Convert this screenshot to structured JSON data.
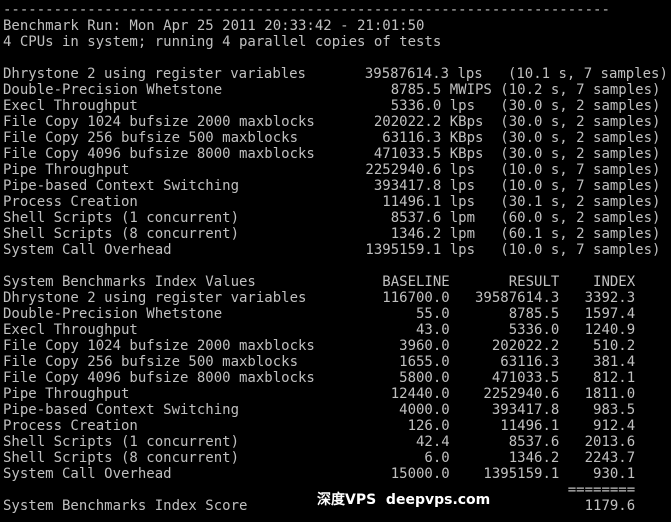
{
  "terminal": {
    "lines": [
      "------------------------------------------------------------------------",
      "Benchmark Run: Mon Apr 25 2011 20:33:42 - 21:01:50",
      "4 CPUs in system; running 4 parallel copies of tests",
      "",
      "Dhrystone 2 using register variables       39587614.3 lps   (10.1 s, 7 samples)",
      "Double-Precision Whetstone                    8785.5 MWIPS (10.2 s, 7 samples)",
      "Execl Throughput                              5336.0 lps   (30.0 s, 2 samples)",
      "File Copy 1024 bufsize 2000 maxblocks       202022.2 KBps  (30.0 s, 2 samples)",
      "File Copy 256 bufsize 500 maxblocks          63116.3 KBps  (30.0 s, 2 samples)",
      "File Copy 4096 bufsize 8000 maxblocks       471033.5 KBps  (30.0 s, 2 samples)",
      "Pipe Throughput                            2252940.6 lps   (10.0 s, 7 samples)",
      "Pipe-based Context Switching                393417.8 lps   (10.0 s, 7 samples)",
      "Process Creation                             11496.1 lps   (30.1 s, 2 samples)",
      "Shell Scripts (1 concurrent)                  8537.6 lpm   (60.0 s, 2 samples)",
      "Shell Scripts (8 concurrent)                  1346.2 lpm   (60.1 s, 2 samples)",
      "System Call Overhead                       1395159.1 lps   (10.0 s, 7 samples)",
      "",
      "System Benchmarks Index Values               BASELINE       RESULT    INDEX",
      "Dhrystone 2 using register variables         116700.0   39587614.3   3392.3",
      "Double-Precision Whetstone                       55.0       8785.5   1597.4",
      "Execl Throughput                                 43.0       5336.0   1240.9",
      "File Copy 1024 bufsize 2000 maxblocks          3960.0     202022.2    510.2",
      "File Copy 256 bufsize 500 maxblocks            1655.0      63116.3    381.4",
      "File Copy 4096 bufsize 8000 maxblocks          5800.0     471033.5    812.1",
      "Pipe Throughput                               12440.0    2252940.6   1811.0",
      "Pipe-based Context Switching                   4000.0     393417.8    983.5",
      "Process Creation                                126.0      11496.1    912.4",
      "Shell Scripts (1 concurrent)                     42.4       8537.6   2013.6",
      "Shell Scripts (8 concurrent)                      6.0       1346.2   2243.7",
      "System Call Overhead                          15000.0    1395159.1    930.1",
      "                                                                   ========",
      "System Benchmarks Index Score                                        1179.6"
    ]
  },
  "watermark": "深度VPS  deepvps.com"
}
